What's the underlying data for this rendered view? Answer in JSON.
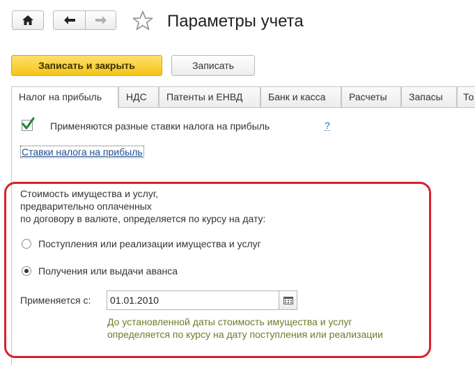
{
  "header": {
    "title": "Параметры учета"
  },
  "toolbar": {
    "save_close_label": "Записать и закрыть",
    "save_label": "Записать"
  },
  "tabs": [
    {
      "label": "Налог на прибыль",
      "active": true
    },
    {
      "label": "НДС",
      "active": false
    },
    {
      "label": "Патенты и ЕНВД",
      "active": false
    },
    {
      "label": "Банк и касса",
      "active": false
    },
    {
      "label": "Расчеты",
      "active": false
    },
    {
      "label": "Запасы",
      "active": false
    },
    {
      "label": "То",
      "active": false
    }
  ],
  "profit_tax": {
    "different_rates_label": "Применяются разные ставки налога на прибыль",
    "different_rates_checked": true,
    "help_label": "?",
    "rates_link": "Ставки налога на прибыль"
  },
  "currency_section": {
    "description_lines": [
      "Стоимость имущества и услуг,",
      "предварительно оплаченных",
      "по договору в валюте, определяется по курсу на дату:"
    ],
    "options": [
      {
        "label": "Поступления или реализации имущества и услуг",
        "selected": false
      },
      {
        "label": "Получения или выдачи аванса",
        "selected": true
      }
    ],
    "applies_from_label": "Применяется с:",
    "applies_from_value": "01.01.2010",
    "note_lines": [
      "До установленной даты стоимость имущества и услуг",
      "определяется по курсу на дату поступления или реализации"
    ]
  },
  "colors": {
    "primary_button": "#f5c518",
    "highlight_border": "#d8202c",
    "checkmark": "#1f8a3a",
    "note_text": "#6f7a2a",
    "link": "#1f4e8c"
  },
  "icons": {
    "home": "home-icon",
    "back": "arrow-left-icon",
    "forward": "arrow-right-icon",
    "favorite": "star-icon",
    "calendar": "calendar-icon",
    "checkbox": "checkmark-icon"
  }
}
